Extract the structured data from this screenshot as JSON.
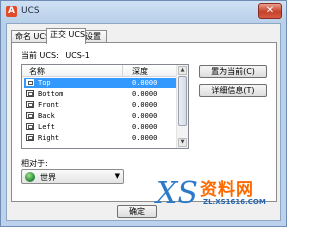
{
  "window": {
    "title": "UCS",
    "app_icon": "autocad-icon",
    "close_label": "✕"
  },
  "tabs": [
    {
      "label": "命名 UCS"
    },
    {
      "label": "正交 UCS"
    },
    {
      "label": "设置"
    }
  ],
  "current_ucs": {
    "label": "当前 UCS:",
    "value": "UCS-1"
  },
  "list": {
    "headers": {
      "name": "名称",
      "depth": "深度"
    },
    "rows": [
      {
        "name": "Top",
        "depth": "0.0000",
        "selected": true
      },
      {
        "name": "Bottom",
        "depth": "0.0000",
        "selected": false
      },
      {
        "name": "Front",
        "depth": "0.0000",
        "selected": false
      },
      {
        "name": "Back",
        "depth": "0.0000",
        "selected": false
      },
      {
        "name": "Left",
        "depth": "0.0000",
        "selected": false
      },
      {
        "name": "Right",
        "depth": "0.0000",
        "selected": false
      }
    ]
  },
  "buttons": {
    "set_current": "置为当前(C)",
    "details": "详细信息(T)",
    "ok": "确定"
  },
  "relative_to": {
    "label": "相对于:",
    "value": "世界"
  },
  "watermark": {
    "logo_mark": "XS",
    "cn": "资料网",
    "url": "ZL.XS1616.COM"
  },
  "colors": {
    "selection": "#3399ff",
    "close_red": "#c5412b"
  }
}
